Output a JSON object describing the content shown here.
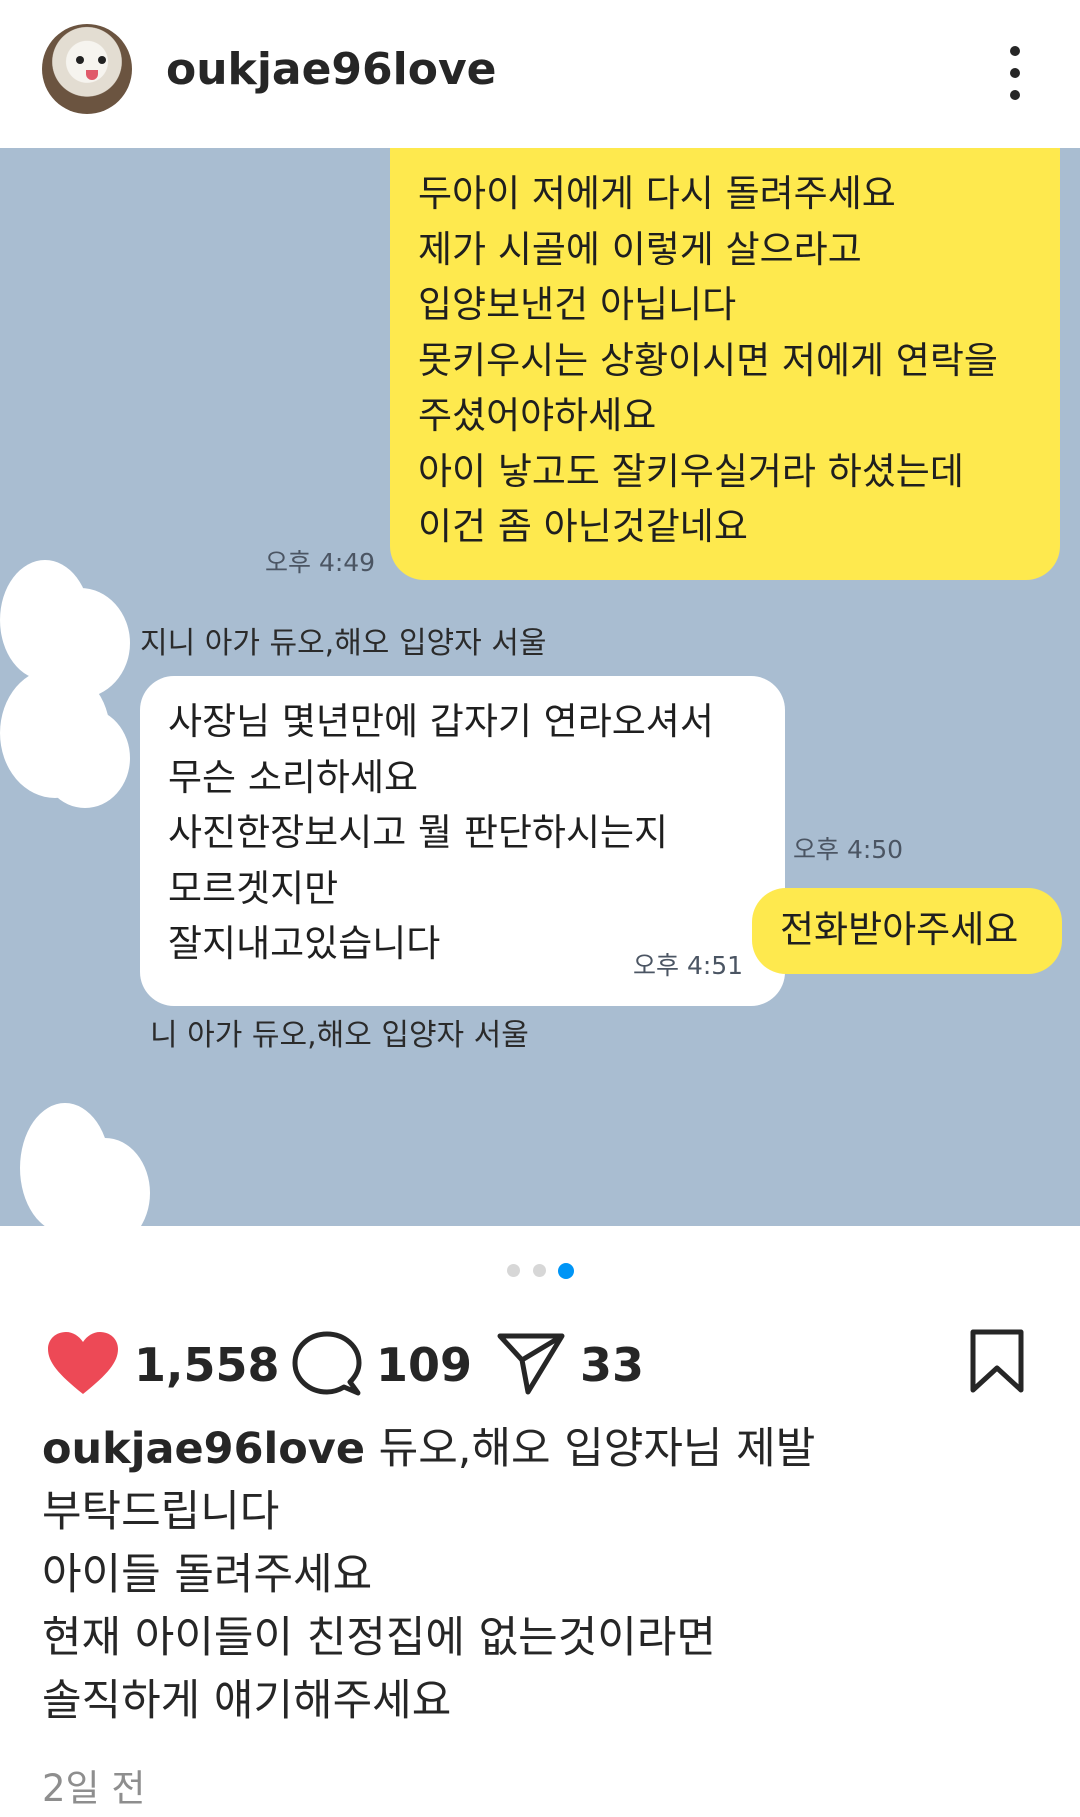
{
  "post": {
    "username": "oukjae96love",
    "menu_icon": "more-vertical-icon"
  },
  "chat": {
    "messages": [
      {
        "from": "me",
        "lines": [
          "두아이 저에게 다시 돌려주세요",
          "제가 시골에 이렇게 살으라고",
          "입양보낸건 아닙니다",
          "못키우시는 상황이시면 저에게 연락을",
          "주셨어야하세요",
          "아이 낳고도 잘키우실거라 하셨는데",
          "이건 좀 아닌것같네요"
        ],
        "time": "오후 4:49"
      },
      {
        "from": "other",
        "sender": "지니 아가 듀오,해오 입양자 서울",
        "lines": [
          "사장님 몇년만에 갑자기 연라오셔서",
          "무슨 소리하세요",
          "사진한장보시고 뭘 판단하시는지",
          "모르겟지만",
          "잘지내고있습니다"
        ],
        "time": "오후 4:50"
      },
      {
        "from": "me",
        "lines": [
          "전화받아주세요"
        ],
        "time": "오후 4:51"
      }
    ],
    "sender_bottom": "니 아가 듀오,해오 입양자 서울"
  },
  "carousel": {
    "count": 3,
    "active": 3
  },
  "actions": {
    "likes": "1,558",
    "comments": "109",
    "shares": "33",
    "like_color": "#ed4956"
  },
  "caption": {
    "username": "oukjae96love",
    "lines": [
      "듀오,해오 입양자님 제발",
      "부탁드립니다",
      "아이들 돌려주세요",
      "현재 아이들이 친정집에 없는것이라면",
      "솔직하게 얘기해주세요"
    ]
  },
  "timestamp": "2일 전",
  "colors": {
    "chat_background": "#a9bdd1",
    "my_bubble": "#fee94e",
    "other_bubble": "#ffffff",
    "accent": "#0095f6"
  }
}
